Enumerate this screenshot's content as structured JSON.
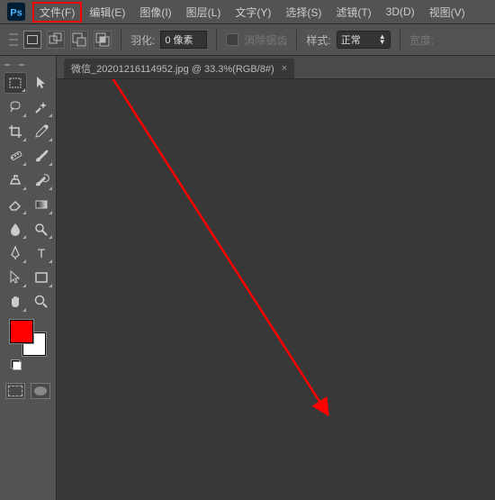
{
  "menu": {
    "file": "文件(F)",
    "edit": "编辑(E)",
    "image": "图像(I)",
    "layer": "图层(L)",
    "type": "文字(Y)",
    "select": "选择(S)",
    "filter": "滤镜(T)",
    "threeD": "3D(D)",
    "view": "视图(V)"
  },
  "options": {
    "feather_label": "羽化:",
    "feather_value": "0 像素",
    "antialias": "消除锯齿",
    "style_label": "样式:",
    "style_value": "正常",
    "width_label": "宽度:"
  },
  "document": {
    "tab_title": "微信_20201216114952.jpg @ 33.3%(RGB/8#)"
  },
  "swatch": {
    "fg": "#ff0000",
    "bg": "#ffffff"
  }
}
